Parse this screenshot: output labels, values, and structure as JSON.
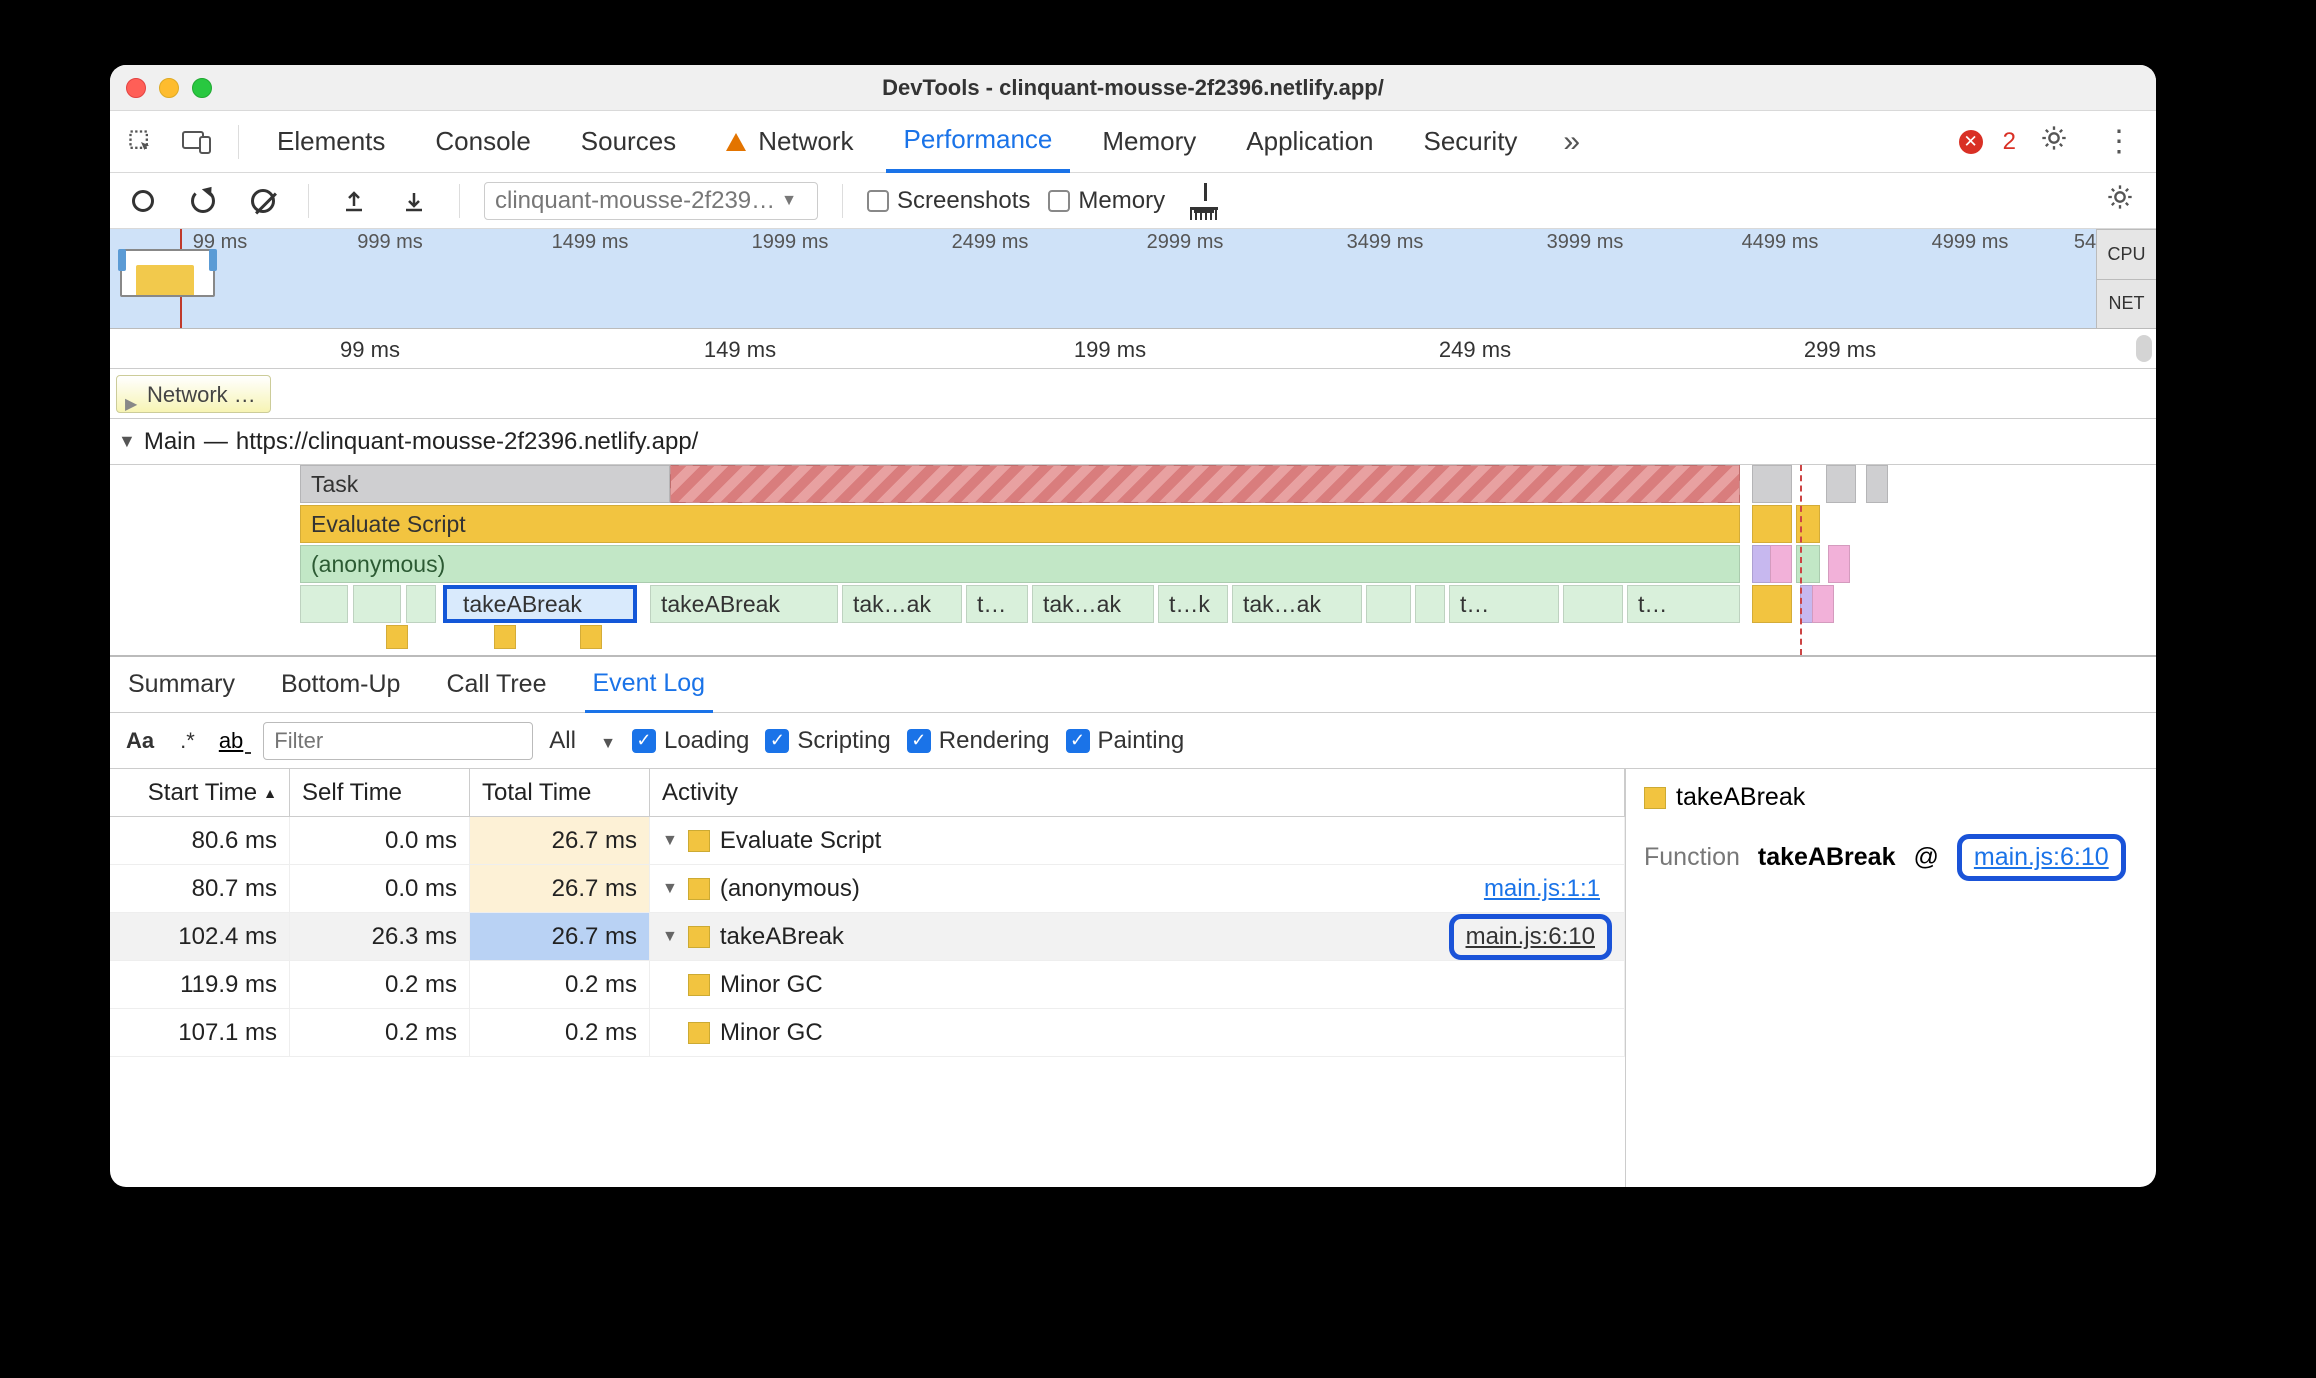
{
  "title": {
    "prefix": "DevTools - ",
    "url": "clinquant-mousse-2f2396.netlify.app/"
  },
  "tabs": {
    "items": [
      "Elements",
      "Console",
      "Sources",
      "Network",
      "Performance",
      "Memory",
      "Application",
      "Security"
    ],
    "active": "Performance",
    "net_warn": true,
    "error_count": "2"
  },
  "perf_toolbar": {
    "profile_name": "clinquant-mousse-2f239…",
    "screenshots_label": "Screenshots",
    "memory_label": "Memory"
  },
  "overview": {
    "ticks": [
      "99 ms",
      "999 ms",
      "1499 ms",
      "1999 ms",
      "2499 ms",
      "2999 ms",
      "3499 ms",
      "3999 ms",
      "4499 ms",
      "4999 ms",
      "54"
    ],
    "side": [
      "CPU",
      "NET"
    ]
  },
  "axis2": [
    "99 ms",
    "149 ms",
    "199 ms",
    "249 ms",
    "299 ms"
  ],
  "network_chip": "Network …",
  "main_header": {
    "label": "Main",
    "url": "https://clinquant-mousse-2f2396.netlify.app/"
  },
  "flame": {
    "rows": [
      {
        "label": "Task"
      },
      {
        "label": "Evaluate Script"
      },
      {
        "label": "(anonymous)"
      }
    ],
    "calls": [
      "takeABreak",
      "takeABreak",
      "tak…ak",
      "t…",
      "tak…ak",
      "t…k",
      "tak…ak",
      "t…",
      "t…"
    ]
  },
  "bottom_tabs": {
    "items": [
      "Summary",
      "Bottom-Up",
      "Call Tree",
      "Event Log"
    ],
    "active": "Event Log"
  },
  "filters": {
    "placeholder": "Filter",
    "all": "All",
    "cats": [
      "Loading",
      "Scripting",
      "Rendering",
      "Painting"
    ]
  },
  "table": {
    "headers": [
      "Start Time",
      "Self Time",
      "Total Time",
      "Activity"
    ],
    "sort_asc": true,
    "rows": [
      {
        "st": "80.6 ms",
        "se": "0.0 ms",
        "tt": "26.7 ms",
        "indent": 0,
        "disc": true,
        "name": "Evaluate Script",
        "link": ""
      },
      {
        "st": "80.7 ms",
        "se": "0.0 ms",
        "tt": "26.7 ms",
        "indent": 1,
        "disc": true,
        "name": "(anonymous)",
        "link": "main.js:1:1"
      },
      {
        "st": "102.4 ms",
        "se": "26.3 ms",
        "tt": "26.7 ms",
        "indent": 2,
        "disc": true,
        "name": "takeABreak",
        "link": "main.js:6:10",
        "selected": true,
        "boxlink": true
      },
      {
        "st": "119.9 ms",
        "se": "0.2 ms",
        "tt": "0.2 ms",
        "indent": 3,
        "disc": false,
        "name": "Minor GC",
        "link": ""
      },
      {
        "st": "107.1 ms",
        "se": "0.2 ms",
        "tt": "0.2 ms",
        "indent": 3,
        "disc": false,
        "name": "Minor GC",
        "link": ""
      }
    ]
  },
  "details": {
    "title": "takeABreak",
    "key": "Function",
    "fn": "takeABreak",
    "at": "@",
    "link": "main.js:6:10"
  }
}
